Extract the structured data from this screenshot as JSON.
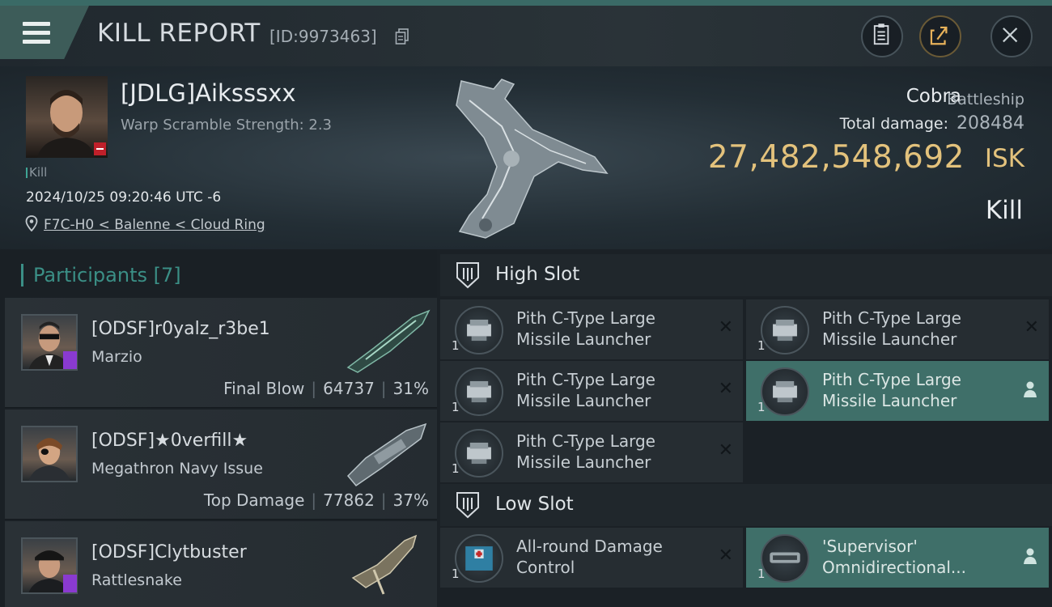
{
  "header": {
    "title": "KILL REPORT",
    "kill_id": "[ID:9973463]",
    "icons": {
      "menu": "menu-icon",
      "copy": "copy-icon",
      "clipboard": "clipboard-icon",
      "share": "share-icon",
      "close": "close-icon"
    }
  },
  "victim": {
    "name": "[JDLG]Aiksssxx",
    "warp_scramble": "Warp Scramble Strength: 2.3",
    "tag": "Kill",
    "date": "2024/10/25 09:20:46 UTC -6",
    "location": "F7C-H0 < Balenne < Cloud Ring",
    "ship_name": "Cobra",
    "ship_class": "Battleship",
    "total_damage_label": "Total damage:",
    "total_damage": "208484",
    "isk_value": "27,482,548,692",
    "isk_unit": "ISK",
    "status": "Kill"
  },
  "participants": {
    "title": "Participants [7]",
    "rows": [
      {
        "name": "[ODSF]r0yalz_r3be1",
        "ship": "Marzio",
        "label": "Final Blow",
        "damage": "64737",
        "percent": "31%"
      },
      {
        "name": "[ODSF]★0verfill★",
        "ship": "Megathron Navy Issue",
        "label": "Top Damage",
        "damage": "77862",
        "percent": "37%"
      },
      {
        "name": "[ODSF]Clytbuster",
        "ship": "Rattlesnake",
        "label": "",
        "damage": "",
        "percent": ""
      }
    ]
  },
  "fitting": {
    "high_slot": {
      "title": "High Slot",
      "modules": [
        {
          "name": "Pith C-Type Large Missile Launcher",
          "qty": "1",
          "mark": "destroyed"
        },
        {
          "name": "Pith C-Type Large Missile Launcher",
          "qty": "1",
          "mark": "destroyed"
        },
        {
          "name": "Pith C-Type Large Missile Launcher",
          "qty": "1",
          "mark": "destroyed"
        },
        {
          "name": "Pith C-Type Large Missile Launcher",
          "qty": "1",
          "mark": "dropped"
        },
        {
          "name": "Pith C-Type Large Missile Launcher",
          "qty": "1",
          "mark": "destroyed"
        }
      ]
    },
    "low_slot": {
      "title": "Low Slot",
      "modules": [
        {
          "name": "All-round Damage Control",
          "qty": "1",
          "mark": "destroyed"
        },
        {
          "name": "'Supervisor' Omnidirectional...",
          "qty": "1",
          "mark": "dropped"
        }
      ]
    }
  },
  "colors": {
    "accent": "#3b8f86",
    "isk": "#e3c27c",
    "highlight": "#3f6f69"
  }
}
